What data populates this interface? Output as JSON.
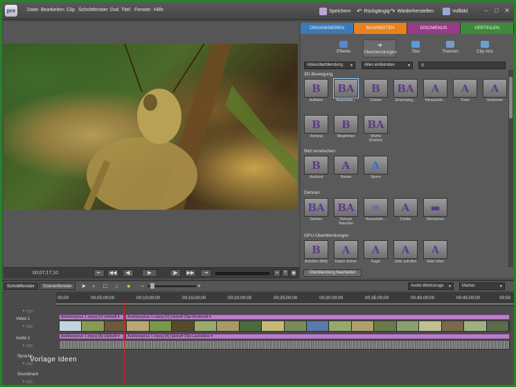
{
  "app": {
    "logo": "pre"
  },
  "menu": [
    "Datei",
    "Bearbeiten",
    "Clip",
    "Schnittfenster",
    "Dvd",
    "Titel",
    "Fenster",
    "Hilfe"
  ],
  "toolbar": {
    "save": "Speichern",
    "undo": "Rückgängig",
    "redo": "Wiederherstellen",
    "fullscreen": "Vollbild"
  },
  "monitor": {
    "timecode": "00;07;17;10"
  },
  "panel": {
    "tabs": [
      {
        "label": "ORGANISIEREN",
        "color": "#3a7ab8"
      },
      {
        "label": "BEARBEITEN",
        "color": "#e8821e"
      },
      {
        "label": "DISCMENUS",
        "color": "#9a3a8a"
      },
      {
        "label": "VERTEILEN",
        "color": "#3f8a3a"
      }
    ],
    "subtabs": [
      "Effekte",
      "Überblendungen",
      "Titel",
      "Themen",
      "Clip Arts"
    ],
    "dropdown1": "Videoüberblendung",
    "dropdown2": "Alles einblenden",
    "categories": [
      {
        "name": "3D-Bewegung",
        "items": [
          "Auffalten",
          "Ausschwin...",
          "Drehen",
          "Einschwing...",
          "Herauslösh...",
          "Türen",
          "Umdrehen",
          "Vorhang",
          "Wegdrehen",
          "Würfel (Drehen)"
        ]
      },
      {
        "name": "Bild verwischen",
        "items": [
          "Hochzeit",
          "Reisen",
          "Sterne"
        ]
      },
      {
        "name": "Dehnen",
        "items": [
          "Dehnen",
          "Dehnen Stauchen",
          "Herauslösh...",
          "Trichter",
          "Überziehen"
        ]
      },
      {
        "name": "GPU-Überblendungen",
        "items": [
          "Aufrollen (Bild)",
          "Karten drehen",
          "Kugel",
          "Seite aufrollen",
          "Seite rollen"
        ]
      }
    ],
    "edit_button": "Überblendung bearbeiten"
  },
  "timeline": {
    "tabs": [
      "Schnittfenster",
      "Szenenfenster"
    ],
    "audio_tools": "Audio-Werkzeuge",
    "marker": "Marker",
    "ruler": [
      "00;00",
      "00;05;00;00",
      "00;10;00;00",
      "00;15;00;00",
      "00;20;00;00",
      "00;25;00;00",
      "00;30;00;00",
      "00;35;00;00",
      "00;40;00;00",
      "00;45;00;00",
      "00;50"
    ],
    "tracks": [
      "Video 1",
      "Audio 1",
      "Sprache",
      "Soundtrack"
    ],
    "video_clip1": "Autobeepirus 1.mpeg [V] (skdraft ▾",
    "video_clip2": "Autobeepirus 1.mpeg [V] (skdraft Clip-Deckkraft ▾",
    "audio_clip1": "Autobeepirus 1.mpeg [A] (skdraft ▾",
    "audio_clip2": "Autobeepirus 1.mpeg [A] (skdraft Clip-Lautstärke ▾",
    "watermark": "Vorlage Ideen"
  }
}
